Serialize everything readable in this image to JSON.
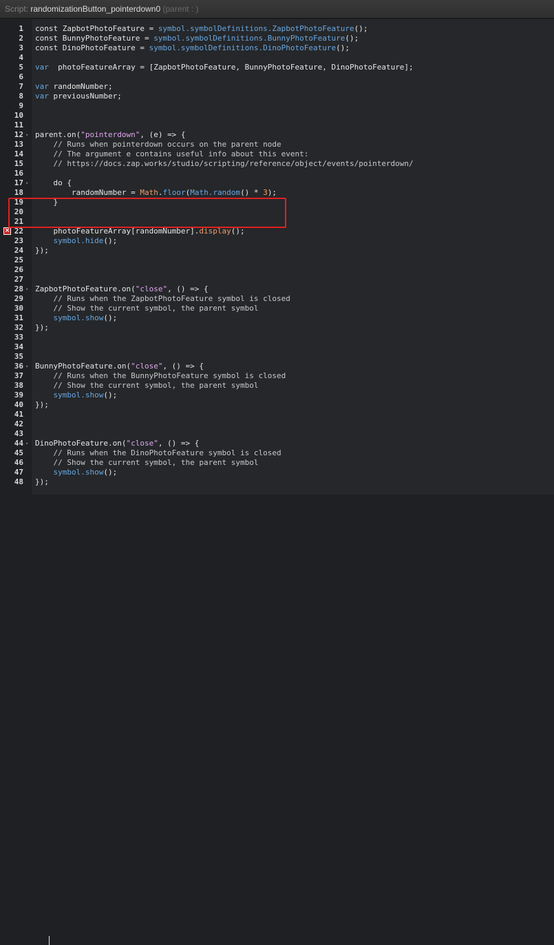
{
  "window": {
    "script_prefix": "Script: ",
    "script_name": "randomizationButton_pointerdown0",
    "parent_label": " (parent : )"
  },
  "error_line": 22,
  "highlighted_lines": [
    17,
    19
  ],
  "lines": [
    {
      "n": 1,
      "tokens": [
        [
          "def",
          "const ZapbotPhotoFeature = "
        ],
        [
          "fn",
          "symbol.symbolDefinitions.ZapbotPhotoFeature"
        ],
        [
          "def",
          "();"
        ]
      ]
    },
    {
      "n": 2,
      "tokens": [
        [
          "def",
          "const BunnyPhotoFeature = "
        ],
        [
          "fn",
          "symbol.symbolDefinitions.BunnyPhotoFeature"
        ],
        [
          "def",
          "();"
        ]
      ]
    },
    {
      "n": 3,
      "tokens": [
        [
          "def",
          "const DinoPhotoFeature = "
        ],
        [
          "fn",
          "symbol.symbolDefinitions.DinoPhotoFeature"
        ],
        [
          "def",
          "();"
        ]
      ]
    },
    {
      "n": 4,
      "tokens": []
    },
    {
      "n": 5,
      "tokens": [
        [
          "kw",
          "var"
        ],
        [
          "def",
          "  photoFeatureArray = [ZapbotPhotoFeature, BunnyPhotoFeature, DinoPhotoFeature];"
        ]
      ]
    },
    {
      "n": 6,
      "tokens": []
    },
    {
      "n": 7,
      "tokens": [
        [
          "kw",
          "var"
        ],
        [
          "def",
          " randomNumber;"
        ]
      ]
    },
    {
      "n": 8,
      "tokens": [
        [
          "kw",
          "var"
        ],
        [
          "def",
          " previousNumber;"
        ]
      ]
    },
    {
      "n": 9,
      "tokens": []
    },
    {
      "n": 10,
      "tokens": []
    },
    {
      "n": 11,
      "tokens": []
    },
    {
      "n": 12,
      "fold": true,
      "tokens": [
        [
          "def",
          "parent.on("
        ],
        [
          "str",
          "\"pointerdown\""
        ],
        [
          "def",
          ", (e) => {"
        ]
      ]
    },
    {
      "n": 13,
      "tokens": [
        [
          "com",
          "    // Runs when pointerdown occurs on the parent node"
        ]
      ]
    },
    {
      "n": 14,
      "tokens": [
        [
          "com",
          "    // The argument e contains useful info about this event:"
        ]
      ]
    },
    {
      "n": 15,
      "tokens": [
        [
          "com",
          "    // https://docs.zap.works/studio/scripting/reference/object/events/pointerdown/"
        ]
      ]
    },
    {
      "n": 16,
      "tokens": []
    },
    {
      "n": 17,
      "fold": true,
      "tokens": [
        [
          "def",
          "    do {"
        ]
      ]
    },
    {
      "n": 18,
      "tokens": [
        [
          "def",
          "        randomNumber = "
        ],
        [
          "math",
          "Math"
        ],
        [
          "def",
          "."
        ],
        [
          "fn",
          "floor"
        ],
        [
          "def",
          "("
        ],
        [
          "fn",
          "Math.random"
        ],
        [
          "def",
          "() * "
        ],
        [
          "num",
          "3"
        ],
        [
          "def",
          ");"
        ]
      ]
    },
    {
      "n": 19,
      "tokens": [
        [
          "def",
          "    }"
        ]
      ]
    },
    {
      "n": 20,
      "tokens": []
    },
    {
      "n": 21,
      "tokens": []
    },
    {
      "n": 22,
      "tokens": [
        [
          "def",
          "    photoFeatureArray[randomNumber]."
        ],
        [
          "math",
          "display"
        ],
        [
          "def",
          "();"
        ]
      ]
    },
    {
      "n": 23,
      "tokens": [
        [
          "fn",
          "    symbol.hide"
        ],
        [
          "def",
          "();"
        ]
      ]
    },
    {
      "n": 24,
      "tokens": [
        [
          "def",
          "});"
        ]
      ]
    },
    {
      "n": 25,
      "tokens": []
    },
    {
      "n": 26,
      "tokens": []
    },
    {
      "n": 27,
      "tokens": []
    },
    {
      "n": 28,
      "fold": true,
      "tokens": [
        [
          "def",
          "ZapbotPhotoFeature.on("
        ],
        [
          "str",
          "\"close\""
        ],
        [
          "def",
          ", () => {"
        ]
      ]
    },
    {
      "n": 29,
      "tokens": [
        [
          "com",
          "    // Runs when the ZapbotPhotoFeature symbol is closed"
        ]
      ]
    },
    {
      "n": 30,
      "tokens": [
        [
          "com",
          "    // Show the current symbol, the parent symbol"
        ]
      ]
    },
    {
      "n": 31,
      "tokens": [
        [
          "fn",
          "    symbol.show"
        ],
        [
          "def",
          "();"
        ]
      ]
    },
    {
      "n": 32,
      "tokens": [
        [
          "def",
          "});"
        ]
      ]
    },
    {
      "n": 33,
      "tokens": []
    },
    {
      "n": 34,
      "tokens": []
    },
    {
      "n": 35,
      "tokens": []
    },
    {
      "n": 36,
      "fold": true,
      "tokens": [
        [
          "def",
          "BunnyPhotoFeature.on("
        ],
        [
          "str",
          "\"close\""
        ],
        [
          "def",
          ", () => {"
        ]
      ]
    },
    {
      "n": 37,
      "tokens": [
        [
          "com",
          "    // Runs when the BunnyPhotoFeature symbol is closed"
        ]
      ]
    },
    {
      "n": 38,
      "tokens": [
        [
          "com",
          "    // Show the current symbol, the parent symbol"
        ]
      ]
    },
    {
      "n": 39,
      "tokens": [
        [
          "fn",
          "    symbol.show"
        ],
        [
          "def",
          "();"
        ]
      ]
    },
    {
      "n": 40,
      "tokens": [
        [
          "def",
          "});"
        ]
      ]
    },
    {
      "n": 41,
      "tokens": []
    },
    {
      "n": 42,
      "tokens": []
    },
    {
      "n": 43,
      "tokens": []
    },
    {
      "n": 44,
      "fold": true,
      "tokens": [
        [
          "def",
          "DinoPhotoFeature.on("
        ],
        [
          "str",
          "\"close\""
        ],
        [
          "def",
          ", () => {"
        ]
      ]
    },
    {
      "n": 45,
      "tokens": [
        [
          "com",
          "    // Runs when the DinoPhotoFeature symbol is closed"
        ]
      ]
    },
    {
      "n": 46,
      "tokens": [
        [
          "com",
          "    // Show the current symbol, the parent symbol"
        ]
      ]
    },
    {
      "n": 47,
      "tokens": [
        [
          "fn",
          "    symbol.show"
        ],
        [
          "def",
          "();"
        ]
      ]
    },
    {
      "n": 48,
      "tokens": [
        [
          "def",
          "});"
        ]
      ]
    }
  ]
}
